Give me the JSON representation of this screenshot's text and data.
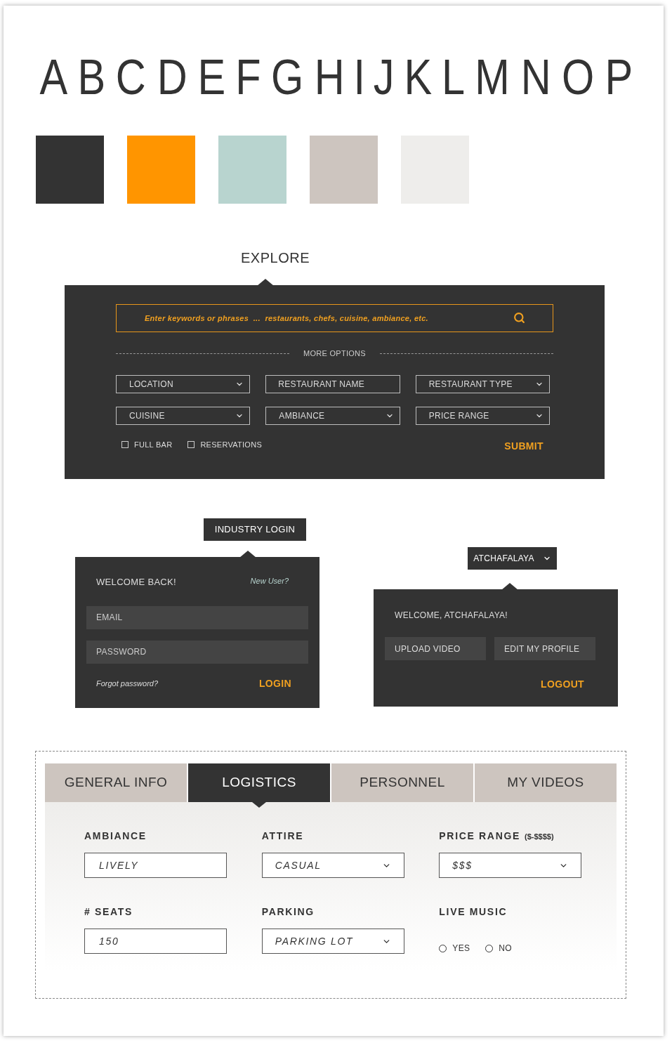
{
  "alphabet": [
    "A",
    "B",
    "C",
    "D",
    "E",
    "F",
    "G",
    "H",
    "I",
    "J",
    "K",
    "L",
    "M",
    "N",
    "O",
    "P"
  ],
  "swatches": [
    {
      "color": "#333333"
    },
    {
      "color": "#ff9500"
    },
    {
      "color": "#b8d4cf"
    },
    {
      "color": "#cdc5bf"
    },
    {
      "color": "#eeedeb"
    }
  ],
  "explore": {
    "title": "EXPLORE",
    "search": {
      "placeholder": "Enter keywords or phrases  ...  restaurants, chefs, cuisine, ambiance, etc."
    },
    "divider_label": "MORE OPTIONS",
    "filters": [
      {
        "kind": "dropdown",
        "label": "LOCATION"
      },
      {
        "kind": "text",
        "placeholder": "RESTAURANT NAME"
      },
      {
        "kind": "dropdown",
        "label": "RESTAURANT TYPE"
      },
      {
        "kind": "dropdown",
        "label": "CUISINE"
      },
      {
        "kind": "dropdown",
        "label": "AMBIANCE"
      },
      {
        "kind": "dropdown",
        "label": "PRICE RANGE"
      }
    ],
    "checkboxes": [
      {
        "label": "FULL BAR",
        "checked": false
      },
      {
        "label": "RESERVATIONS",
        "checked": false
      }
    ],
    "submit": "SUBMIT"
  },
  "login": {
    "tab": "INDUSTRY LOGIN",
    "heading": "WELCOME BACK!",
    "new_user": "New User?",
    "fields": [
      {
        "placeholder": "EMAIL"
      },
      {
        "placeholder": "PASSWORD"
      }
    ],
    "forgot": "Forgot password?",
    "button": "LOGIN"
  },
  "account": {
    "menu": "ATCHAFALAYA",
    "greeting": "WELCOME, ATCHAFALAYA!",
    "buttons": [
      "UPLOAD VIDEO",
      "EDIT MY PROFILE"
    ],
    "logout": "LOGOUT"
  },
  "profile": {
    "tabs": [
      {
        "label": "GENERAL INFO",
        "selected": false
      },
      {
        "label": "LOGISTICS",
        "selected": true
      },
      {
        "label": "PERSONNEL",
        "selected": false
      },
      {
        "label": "MY VIDEOS",
        "selected": false
      }
    ],
    "fields": [
      {
        "kind": "text",
        "label": "AMBIANCE",
        "value": "LIVELY"
      },
      {
        "kind": "dropdown",
        "label": "ATTIRE",
        "value": "CASUAL"
      },
      {
        "kind": "dropdown",
        "label": "PRICE RANGE",
        "hint": "($-$$$$)",
        "value": "$$$"
      },
      {
        "kind": "text",
        "label": "# SEATS",
        "value": "150"
      },
      {
        "kind": "dropdown",
        "label": "PARKING",
        "value": "PARKING LOT"
      },
      {
        "kind": "radio",
        "label": "LIVE MUSIC",
        "options": [
          {
            "label": "YES",
            "selected": false
          },
          {
            "label": "NO",
            "selected": false
          }
        ]
      }
    ]
  }
}
